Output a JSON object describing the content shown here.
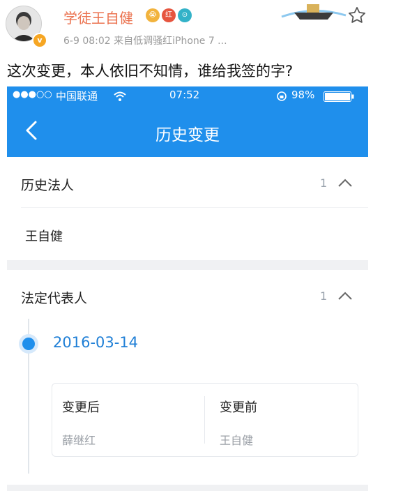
{
  "post": {
    "username": "学徒王自健",
    "meta": "6-9 08:02  来自低调骚红iPhone 7 ...",
    "text": "这次变更，本人依旧不知情，谁给我签的字?",
    "badges": [
      "😭",
      "红",
      "⊙"
    ],
    "verified_badge": "v"
  },
  "phone": {
    "status": {
      "signal": "●●●○○",
      "carrier": "中国联通",
      "time": "07:52",
      "battery": "98%"
    },
    "nav": {
      "title": "历史变更",
      "back_icon": "chevron-left-icon"
    },
    "sections": [
      {
        "title": "历史法人",
        "count": "1",
        "value": "王自健"
      },
      {
        "title": "法定代表人",
        "count": "1"
      }
    ],
    "timeline": {
      "date": "2016-03-14",
      "after_label": "变更后",
      "after_value": "薛继红",
      "before_label": "变更前",
      "before_value": "王自健"
    }
  },
  "colors": {
    "accent": "#1f8fec",
    "username": "#eb7350",
    "date": "#1f7fd6"
  }
}
